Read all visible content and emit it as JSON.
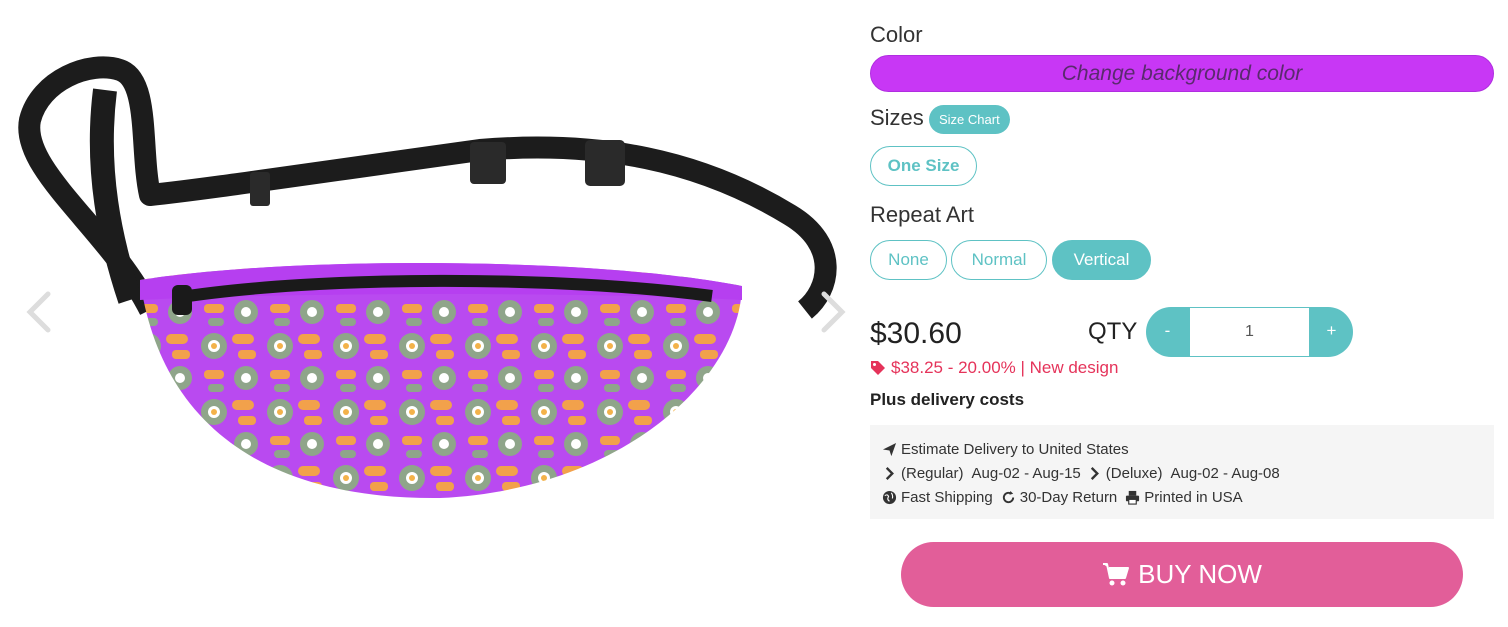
{
  "colors": {
    "accent": "#5ec2c4",
    "color_button": "#c837f5",
    "buy": "#e25e99",
    "discount": "#e5335a",
    "bag_purple": "#b94af0"
  },
  "gallery": {
    "prev_icon": "chevron-left-icon",
    "next_icon": "chevron-right-icon"
  },
  "color": {
    "label": "Color",
    "button": "Change background color"
  },
  "sizes": {
    "label": "Sizes",
    "chart_label": "Size Chart",
    "options": [
      "One Size"
    ]
  },
  "repeat_art": {
    "label": "Repeat Art",
    "options": [
      "None",
      "Normal",
      "Vertical"
    ],
    "selected": "Vertical"
  },
  "price": {
    "current": "$30.60",
    "discount_line": "$38.25 - 20.00% | New design",
    "delivery_note": "Plus delivery costs"
  },
  "qty": {
    "label": "QTY",
    "minus": "-",
    "plus": "+",
    "value": "1"
  },
  "delivery": {
    "estimate": "Estimate Delivery to United States",
    "regular_label": "(Regular)",
    "regular_dates": "Aug-02 - Aug-15",
    "deluxe_label": "(Deluxe)",
    "deluxe_dates": "Aug-02 - Aug-08",
    "fast_shipping": "Fast Shipping",
    "returns": "30-Day Return",
    "printed": "Printed in USA"
  },
  "buy": {
    "label": "BUY NOW"
  }
}
